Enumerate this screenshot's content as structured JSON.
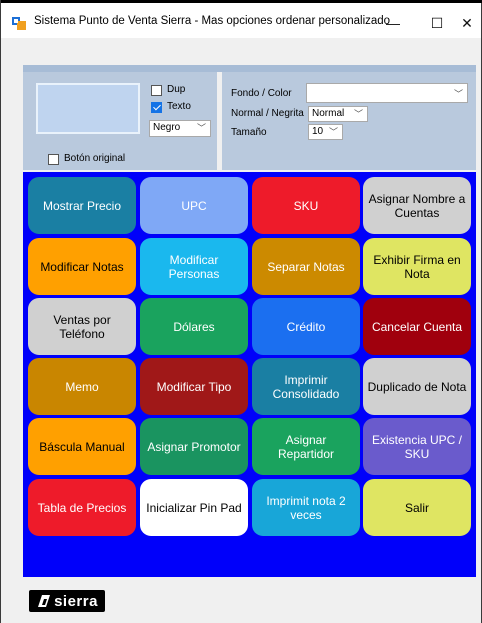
{
  "window": {
    "title": "Sistema Punto de Venta Sierra  -  Mas opciones ordenar personalizado",
    "minimize": "—",
    "maximize": "☐",
    "close": "✕"
  },
  "options": {
    "dup_label": "Dup",
    "dup_checked": false,
    "texto_label": "Texto",
    "texto_checked": true,
    "color_select_value": "Negro",
    "boton_original_label": "Botón original",
    "fondo_color_label": "Fondo / Color",
    "fondo_color_value": "",
    "normal_negrita_label": "Normal / Negrita",
    "normal_negrita_value": "Normal",
    "tamano_label": "Tamaño",
    "tamano_value": "10"
  },
  "buttons": [
    {
      "label": "Mostrar Precio",
      "bg": "#1a7fa3",
      "fg": "#ffffff"
    },
    {
      "label": "UPC",
      "bg": "#7fa8f6",
      "fg": "#ffffff"
    },
    {
      "label": "SKU",
      "bg": "#ee1b2a",
      "fg": "#ffffff"
    },
    {
      "label": "Asignar Nombre a Cuentas",
      "bg": "#d0d0d0",
      "fg": "#000000"
    },
    {
      "label": "Modificar Notas",
      "bg": "#ffa000",
      "fg": "#000000"
    },
    {
      "label": "Modificar Personas",
      "bg": "#1ab8ee",
      "fg": "#ffffff"
    },
    {
      "label": "Separar Notas",
      "bg": "#cc8a00",
      "fg": "#ffffff"
    },
    {
      "label": "Exhibir Firma en Nota",
      "bg": "#dfe562",
      "fg": "#000000"
    },
    {
      "label": "Ventas por Teléfono",
      "bg": "#d0d0d0",
      "fg": "#000000"
    },
    {
      "label": "Dólares",
      "bg": "#1aa35e",
      "fg": "#ffffff"
    },
    {
      "label": "Crédito",
      "bg": "#1b6ff0",
      "fg": "#ffffff"
    },
    {
      "label": "Cancelar Cuenta",
      "bg": "#a0000d",
      "fg": "#ffffff"
    },
    {
      "label": "Memo",
      "bg": "#c98600",
      "fg": "#ffffff"
    },
    {
      "label": "Modificar Tipo",
      "bg": "#a01818",
      "fg": "#ffffff"
    },
    {
      "label": "Imprimir Consolidado",
      "bg": "#1a7fa3",
      "fg": "#ffffff"
    },
    {
      "label": "Duplicado de Nota",
      "bg": "#d0d0d0",
      "fg": "#000000"
    },
    {
      "label": "Báscula Manual",
      "bg": "#ffa000",
      "fg": "#000000"
    },
    {
      "label": "Asignar Promotor",
      "bg": "#1a9460",
      "fg": "#ffffff"
    },
    {
      "label": "Asignar Repartidor",
      "bg": "#1aa35e",
      "fg": "#ffffff"
    },
    {
      "label": "Existencia UPC / SKU",
      "bg": "#6a5bcc",
      "fg": "#ffffff"
    },
    {
      "label": "Tabla de Precios",
      "bg": "#ee1b2a",
      "fg": "#ffffff"
    },
    {
      "label": "Inicializar Pin Pad",
      "bg": "#ffffff",
      "fg": "#000000"
    },
    {
      "label": "Imprimit nota 2 veces",
      "bg": "#18a6d8",
      "fg": "#ffffff"
    },
    {
      "label": "Salir",
      "bg": "#dfe562",
      "fg": "#000000"
    }
  ],
  "logo": {
    "text": "sierra"
  }
}
